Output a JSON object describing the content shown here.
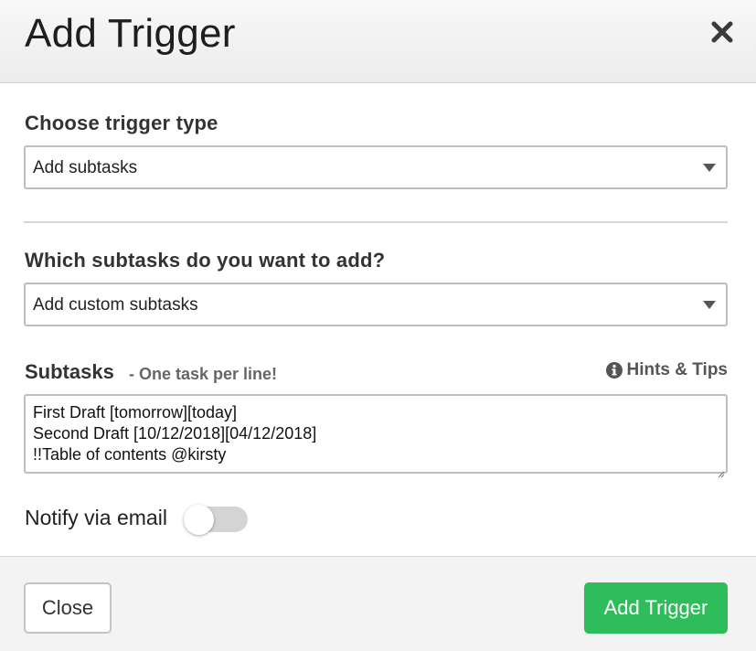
{
  "modal": {
    "title": "Add Trigger"
  },
  "trigger_type": {
    "label": "Choose trigger type",
    "value": "Add subtasks"
  },
  "subtask_source": {
    "label": "Which subtasks do you want to add?",
    "value": "Add custom subtasks"
  },
  "subtasks": {
    "label": "Subtasks",
    "hint": "- One task per line!",
    "hints_link": "Hints & Tips",
    "lines": [
      "First Draft [tomorrow][today]",
      "Second Draft [10/12/2018][04/12/2018]",
      "!!Table of contents @kirsty"
    ]
  },
  "notify": {
    "label": "Notify via email",
    "enabled": false
  },
  "footer": {
    "close_label": "Close",
    "submit_label": "Add Trigger"
  },
  "colors": {
    "primary": "#2fbd5c",
    "toggle_off": "#d4d4d4"
  },
  "icons": {
    "close": "close-icon",
    "caret": "caret-down-icon",
    "info": "info-icon"
  }
}
